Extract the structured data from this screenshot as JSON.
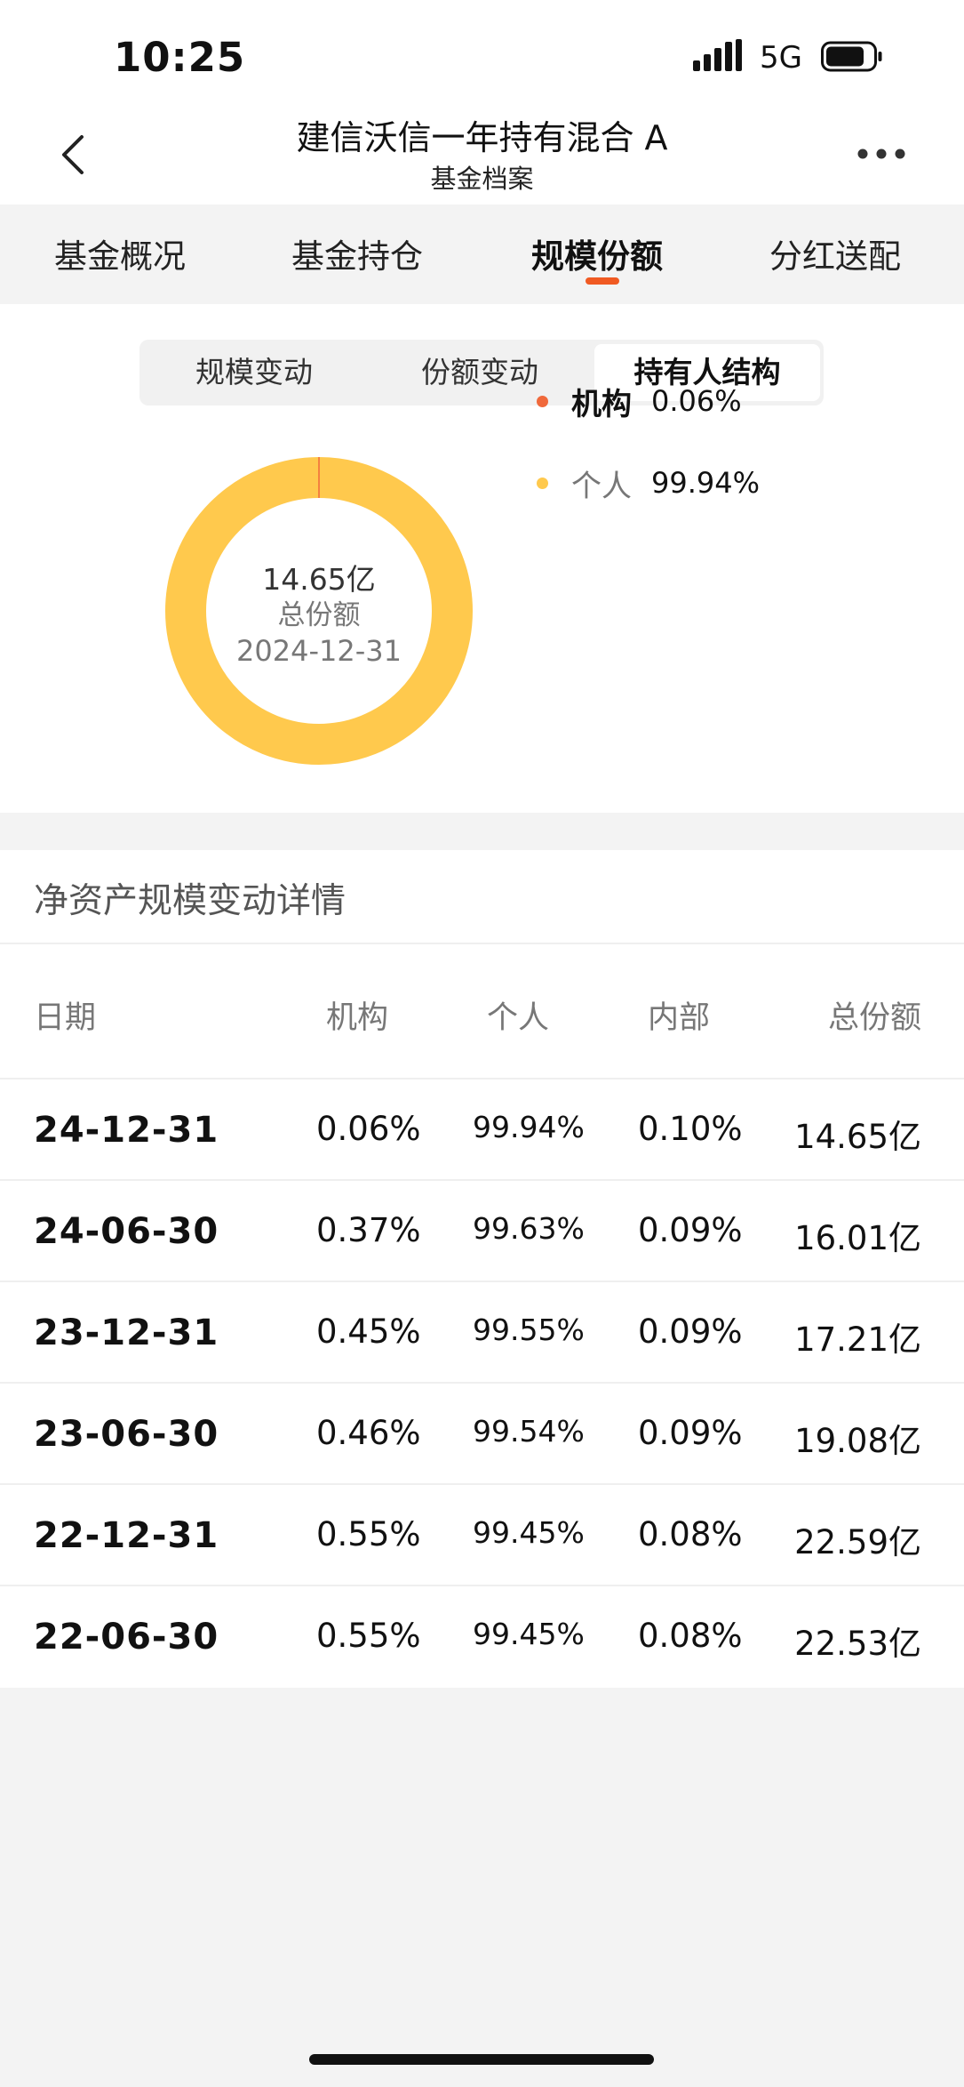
{
  "status_bar": {
    "time": "10:25",
    "network": "5G"
  },
  "nav": {
    "title": "建信沃信一年持有混合 A",
    "subtitle": "基金档案"
  },
  "tabs": [
    {
      "label": "基金概况"
    },
    {
      "label": "基金持仓"
    },
    {
      "label": "规模份额",
      "active": true
    },
    {
      "label": "分红送配"
    }
  ],
  "segments": [
    {
      "label": "规模变动"
    },
    {
      "label": "份额变动"
    },
    {
      "label": "持有人结构",
      "active": true
    }
  ],
  "donut": {
    "value": "14.65亿",
    "label": "总份额",
    "date": "2024-12-31"
  },
  "chart_data": {
    "type": "pie",
    "title": "",
    "slices": [
      {
        "name": "机构",
        "value": 0.06,
        "display": "0.06%",
        "color": "#f0693b"
      },
      {
        "name": "个人",
        "value": 99.94,
        "display": "99.94%",
        "color": "#ffc94d"
      }
    ]
  },
  "table": {
    "title": "净资产规模变动详情",
    "headers": [
      "日期",
      "机构",
      "个人",
      "内部",
      "总份额"
    ],
    "rows": [
      [
        "24-12-31",
        "0.06%",
        "99.94%",
        "0.10%",
        "14.65亿"
      ],
      [
        "24-06-30",
        "0.37%",
        "99.63%",
        "0.09%",
        "16.01亿"
      ],
      [
        "23-12-31",
        "0.45%",
        "99.55%",
        "0.09%",
        "17.21亿"
      ],
      [
        "23-06-30",
        "0.46%",
        "99.54%",
        "0.09%",
        "19.08亿"
      ],
      [
        "22-12-31",
        "0.55%",
        "99.45%",
        "0.08%",
        "22.59亿"
      ],
      [
        "22-06-30",
        "0.55%",
        "99.45%",
        "0.08%",
        "22.53亿"
      ]
    ]
  },
  "colors": {
    "accent": "#f05a22",
    "institution": "#f0693b",
    "individual": "#ffc94d"
  }
}
